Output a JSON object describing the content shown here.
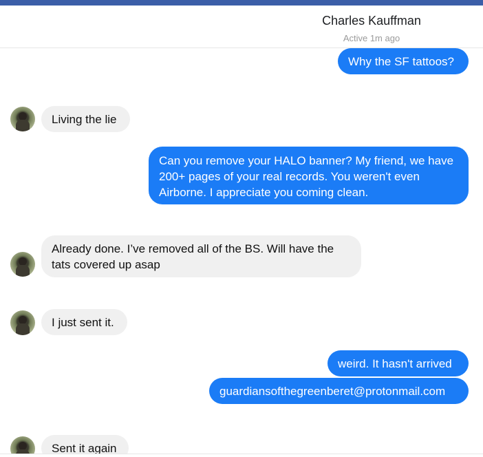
{
  "header": {
    "contact_name": "Charles Kauffman",
    "status": "Active 1m ago"
  },
  "messages": [
    {
      "side": "out",
      "text": "Why the SF tattoos?"
    },
    {
      "side": "in",
      "text": "Living the lie"
    },
    {
      "side": "out",
      "text": "Can you remove your HALO banner? My friend, we have 200+ pages of your real records. You weren't even Airborne. I appreciate you coming clean."
    },
    {
      "side": "in",
      "text": "Already done.  I’ve removed all of the BS.  Will have the tats covered up asap"
    },
    {
      "side": "in",
      "text": "I just sent it."
    },
    {
      "side": "out",
      "text": "weird. It hasn't arrived"
    },
    {
      "side": "out",
      "text": "guardiansofthegreenberet@protonmail.com"
    },
    {
      "side": "in",
      "text": "Sent it again"
    }
  ],
  "colors": {
    "outgoing_bubble": "#1b7cf6",
    "incoming_bubble": "#f0f0f0",
    "top_bar": "#3b5ea8"
  }
}
